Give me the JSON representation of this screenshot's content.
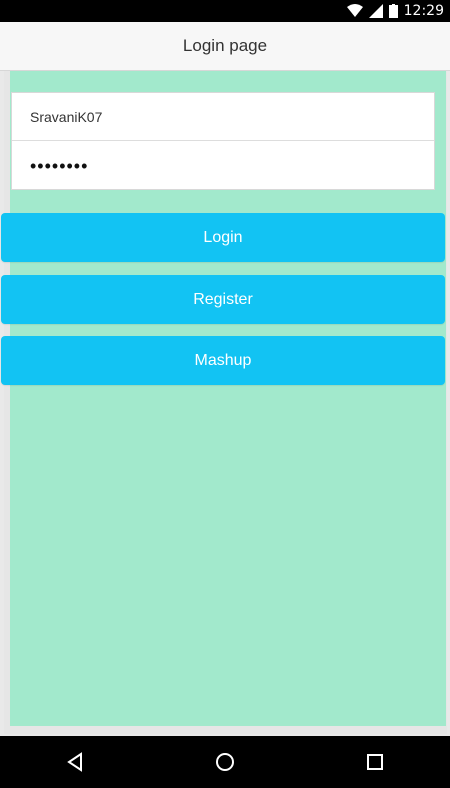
{
  "status_bar": {
    "time": "12:29",
    "icons": [
      "wifi-icon",
      "signal-icon",
      "battery-icon"
    ]
  },
  "header": {
    "title": "Login page"
  },
  "form": {
    "username_value": "SravaniK07",
    "password_masked": "••••••••"
  },
  "buttons": {
    "login_label": "Login",
    "register_label": "Register",
    "mashup_label": "Mashup"
  },
  "nav": {
    "icons": [
      "back-icon",
      "home-icon",
      "recents-icon"
    ]
  },
  "colors": {
    "background_content": "#a2e9cc",
    "button": "#12c3f3",
    "header_bg": "#f7f7f7"
  }
}
